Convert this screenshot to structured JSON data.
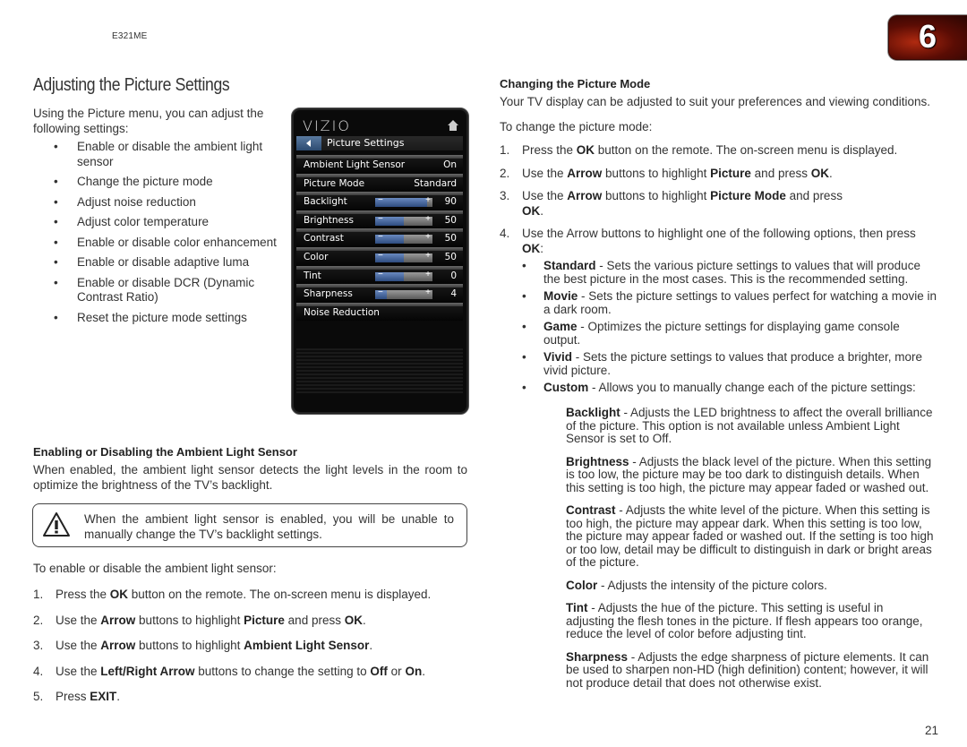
{
  "header": {
    "model": "E321ME",
    "chapter_number": "6",
    "page_number": "21"
  },
  "page_title": "Adjusting the Picture Settings",
  "intro": "Using the Picture menu, you can adjust the following settings:",
  "features": [
    "Enable or disable the ambient light sensor",
    "Change the picture mode",
    "Adjust noise reduction",
    "Adjust color temperature",
    "Enable or disable color enhancement",
    "Enable or disable adaptive luma",
    "Enable or disable DCR (Dynamic Contrast Ratio)",
    "Reset the picture mode settings"
  ],
  "tv_menu": {
    "brand": "VIZIO",
    "title": "Picture Settings",
    "rows": [
      {
        "label": "Ambient Light Sensor",
        "value": "On",
        "slider": null
      },
      {
        "label": "Picture Mode",
        "value": "Standard",
        "slider": null
      },
      {
        "label": "Backlight",
        "value": "90",
        "slider": 0.9
      },
      {
        "label": "Brightness",
        "value": "50",
        "slider": 0.5
      },
      {
        "label": "Contrast",
        "value": "50",
        "slider": 0.5
      },
      {
        "label": "Color",
        "value": "50",
        "slider": 0.5
      },
      {
        "label": "Tint",
        "value": "0",
        "slider": 0.5
      },
      {
        "label": "Sharpness",
        "value": "4",
        "slider": 0.2
      },
      {
        "label": "Noise Reduction",
        "value": "",
        "slider": null
      }
    ]
  },
  "ambient_section": {
    "heading": "Enabling or Disabling the Ambient Light Sensor",
    "body": "When enabled, the ambient light sensor detects the light levels in the room to optimize the brightness of the TV’s backlight.",
    "note": "When the ambient light sensor is enabled, you will be unable to manually change the TV’s backlight settings.",
    "lead": "To enable or disable the ambient light sensor:",
    "steps": [
      [
        "Press the ",
        {
          "b": "OK"
        },
        " button on the remote. The on-screen menu is displayed."
      ],
      [
        "Use the ",
        {
          "b": "Arrow"
        },
        " buttons to highlight ",
        {
          "b": "Picture"
        },
        " and press ",
        {
          "b": "OK"
        },
        "."
      ],
      [
        "Use the ",
        {
          "b": "Arrow"
        },
        " buttons to highlight ",
        {
          "b": "Ambient Light Sensor"
        },
        "."
      ],
      [
        "Use the ",
        {
          "b": "Left/Right Arrow"
        },
        " buttons to change the setting to ",
        {
          "b": "Off"
        },
        " or ",
        {
          "b": "On"
        },
        "."
      ],
      [
        "Press ",
        {
          "b": "EXIT"
        },
        "."
      ]
    ]
  },
  "mode_section": {
    "heading": "Changing the Picture Mode",
    "body": "Your TV display can be adjusted to suit your preferences and viewing conditions.",
    "lead": "To change the picture mode:",
    "steps": [
      [
        "Press the ",
        {
          "b": "OK"
        },
        " button on the remote. The on-screen menu is displayed."
      ],
      [
        "Use the ",
        {
          "b": "Arrow"
        },
        " buttons to highlight ",
        {
          "b": "Picture"
        },
        " and press ",
        {
          "b": "OK"
        },
        "."
      ],
      [
        "Use the ",
        {
          "b": "Arrow"
        },
        " buttons to highlight ",
        {
          "b": "Picture Mode"
        },
        " and press ",
        {
          "br": true
        },
        {
          "b": "OK"
        },
        "."
      ],
      [
        "Use the Arrow buttons to highlight one of the following options, then press ",
        {
          "b": "OK"
        },
        ":"
      ]
    ],
    "options": [
      {
        "name": "Standard",
        "desc": " - Sets the various picture settings to values that will produce the best picture in the most cases. This is the recommended setting."
      },
      {
        "name": "Movie",
        "desc": " - Sets the picture settings to values perfect for watching a movie in a dark room."
      },
      {
        "name": "Game",
        "desc": " - Optimizes the picture settings for displaying game console output."
      },
      {
        "name": "Vivid",
        "desc": " - Sets the picture settings to values that produce a brighter, more vivid picture."
      },
      {
        "name": "Custom",
        "desc": " - Allows you to manually change each of the picture settings:"
      }
    ],
    "definitions": [
      {
        "name": "Backlight",
        "desc": " - Adjusts the LED brightness to affect the overall brilliance of the picture. This option is not available unless Ambient Light Sensor is set to Off."
      },
      {
        "name": "Brightness",
        "desc": " - Adjusts the black level of the picture. When this setting is too low, the picture may be too dark to distinguish details. When this setting is too high, the picture may appear faded or washed out."
      },
      {
        "name": "Contrast",
        "desc": " - Adjusts the white level of the picture. When this setting is too high, the picture may appear dark. When this setting is too low, the picture may appear faded or washed out. If the setting is too high or too low, detail may be difficult to distinguish in dark or bright areas of the picture."
      },
      {
        "name": "Color",
        "desc": " - Adjusts the intensity of the picture colors."
      },
      {
        "name": "Tint",
        "desc": " - Adjusts the hue of the picture. This setting is useful in adjusting the flesh tones in the picture. If flesh appears too orange, reduce the level of color before adjusting tint."
      },
      {
        "name": "Sharpness",
        "desc": " - Adjusts the edge sharpness of picture elements. It can be used to sharpen non-HD (high definition) content; however, it will not produce detail that does not otherwise exist."
      }
    ]
  }
}
